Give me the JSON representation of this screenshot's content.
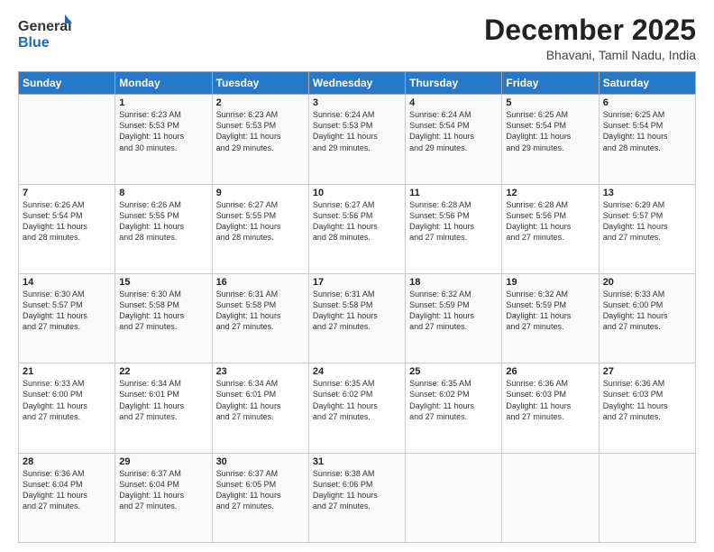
{
  "header": {
    "logo_line1": "General",
    "logo_line2": "Blue",
    "month": "December 2025",
    "location": "Bhavani, Tamil Nadu, India"
  },
  "days_of_week": [
    "Sunday",
    "Monday",
    "Tuesday",
    "Wednesday",
    "Thursday",
    "Friday",
    "Saturday"
  ],
  "weeks": [
    [
      {
        "day": "",
        "info": ""
      },
      {
        "day": "1",
        "info": "Sunrise: 6:23 AM\nSunset: 5:53 PM\nDaylight: 11 hours\nand 30 minutes."
      },
      {
        "day": "2",
        "info": "Sunrise: 6:23 AM\nSunset: 5:53 PM\nDaylight: 11 hours\nand 29 minutes."
      },
      {
        "day": "3",
        "info": "Sunrise: 6:24 AM\nSunset: 5:53 PM\nDaylight: 11 hours\nand 29 minutes."
      },
      {
        "day": "4",
        "info": "Sunrise: 6:24 AM\nSunset: 5:54 PM\nDaylight: 11 hours\nand 29 minutes."
      },
      {
        "day": "5",
        "info": "Sunrise: 6:25 AM\nSunset: 5:54 PM\nDaylight: 11 hours\nand 29 minutes."
      },
      {
        "day": "6",
        "info": "Sunrise: 6:25 AM\nSunset: 5:54 PM\nDaylight: 11 hours\nand 28 minutes."
      }
    ],
    [
      {
        "day": "7",
        "info": "Sunrise: 6:26 AM\nSunset: 5:54 PM\nDaylight: 11 hours\nand 28 minutes."
      },
      {
        "day": "8",
        "info": "Sunrise: 6:26 AM\nSunset: 5:55 PM\nDaylight: 11 hours\nand 28 minutes."
      },
      {
        "day": "9",
        "info": "Sunrise: 6:27 AM\nSunset: 5:55 PM\nDaylight: 11 hours\nand 28 minutes."
      },
      {
        "day": "10",
        "info": "Sunrise: 6:27 AM\nSunset: 5:56 PM\nDaylight: 11 hours\nand 28 minutes."
      },
      {
        "day": "11",
        "info": "Sunrise: 6:28 AM\nSunset: 5:56 PM\nDaylight: 11 hours\nand 27 minutes."
      },
      {
        "day": "12",
        "info": "Sunrise: 6:28 AM\nSunset: 5:56 PM\nDaylight: 11 hours\nand 27 minutes."
      },
      {
        "day": "13",
        "info": "Sunrise: 6:29 AM\nSunset: 5:57 PM\nDaylight: 11 hours\nand 27 minutes."
      }
    ],
    [
      {
        "day": "14",
        "info": "Sunrise: 6:30 AM\nSunset: 5:57 PM\nDaylight: 11 hours\nand 27 minutes."
      },
      {
        "day": "15",
        "info": "Sunrise: 6:30 AM\nSunset: 5:58 PM\nDaylight: 11 hours\nand 27 minutes."
      },
      {
        "day": "16",
        "info": "Sunrise: 6:31 AM\nSunset: 5:58 PM\nDaylight: 11 hours\nand 27 minutes."
      },
      {
        "day": "17",
        "info": "Sunrise: 6:31 AM\nSunset: 5:58 PM\nDaylight: 11 hours\nand 27 minutes."
      },
      {
        "day": "18",
        "info": "Sunrise: 6:32 AM\nSunset: 5:59 PM\nDaylight: 11 hours\nand 27 minutes."
      },
      {
        "day": "19",
        "info": "Sunrise: 6:32 AM\nSunset: 5:59 PM\nDaylight: 11 hours\nand 27 minutes."
      },
      {
        "day": "20",
        "info": "Sunrise: 6:33 AM\nSunset: 6:00 PM\nDaylight: 11 hours\nand 27 minutes."
      }
    ],
    [
      {
        "day": "21",
        "info": "Sunrise: 6:33 AM\nSunset: 6:00 PM\nDaylight: 11 hours\nand 27 minutes."
      },
      {
        "day": "22",
        "info": "Sunrise: 6:34 AM\nSunset: 6:01 PM\nDaylight: 11 hours\nand 27 minutes."
      },
      {
        "day": "23",
        "info": "Sunrise: 6:34 AM\nSunset: 6:01 PM\nDaylight: 11 hours\nand 27 minutes."
      },
      {
        "day": "24",
        "info": "Sunrise: 6:35 AM\nSunset: 6:02 PM\nDaylight: 11 hours\nand 27 minutes."
      },
      {
        "day": "25",
        "info": "Sunrise: 6:35 AM\nSunset: 6:02 PM\nDaylight: 11 hours\nand 27 minutes."
      },
      {
        "day": "26",
        "info": "Sunrise: 6:36 AM\nSunset: 6:03 PM\nDaylight: 11 hours\nand 27 minutes."
      },
      {
        "day": "27",
        "info": "Sunrise: 6:36 AM\nSunset: 6:03 PM\nDaylight: 11 hours\nand 27 minutes."
      }
    ],
    [
      {
        "day": "28",
        "info": "Sunrise: 6:36 AM\nSunset: 6:04 PM\nDaylight: 11 hours\nand 27 minutes."
      },
      {
        "day": "29",
        "info": "Sunrise: 6:37 AM\nSunset: 6:04 PM\nDaylight: 11 hours\nand 27 minutes."
      },
      {
        "day": "30",
        "info": "Sunrise: 6:37 AM\nSunset: 6:05 PM\nDaylight: 11 hours\nand 27 minutes."
      },
      {
        "day": "31",
        "info": "Sunrise: 6:38 AM\nSunset: 6:06 PM\nDaylight: 11 hours\nand 27 minutes."
      },
      {
        "day": "",
        "info": ""
      },
      {
        "day": "",
        "info": ""
      },
      {
        "day": "",
        "info": ""
      }
    ]
  ]
}
